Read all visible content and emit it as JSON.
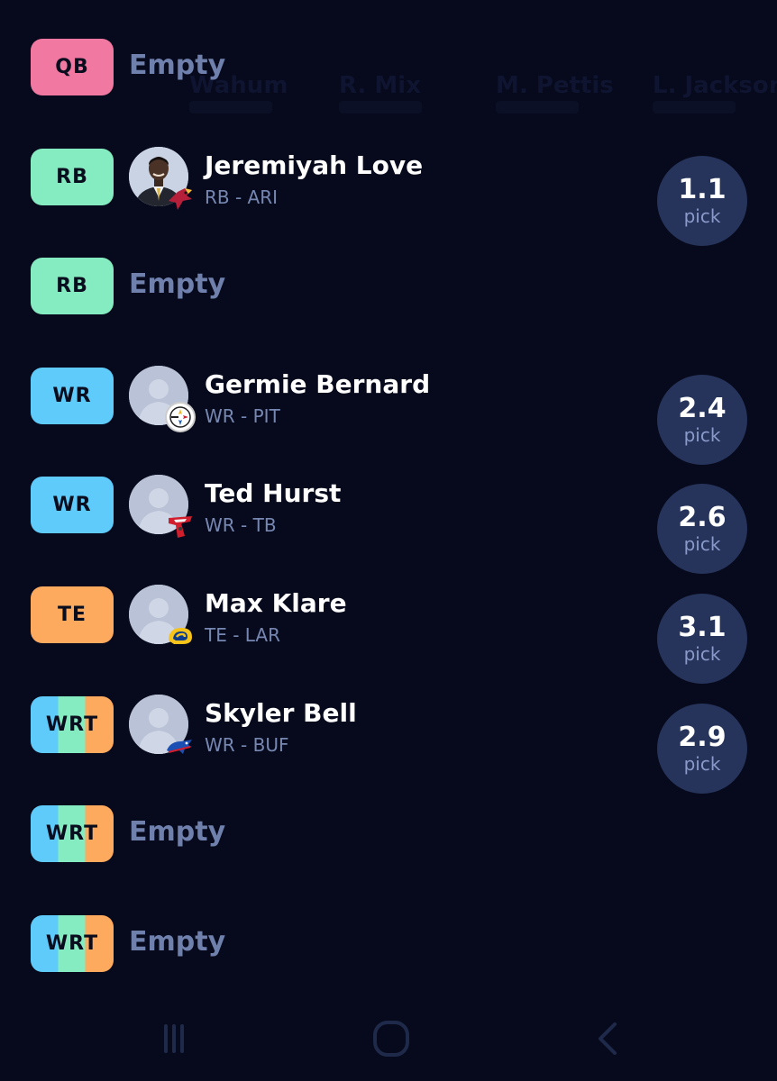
{
  "background_names": [
    "R. Mix",
    "M. Pettis",
    "L. Jackson",
    "Wahum"
  ],
  "slots": [
    {
      "position": "QB",
      "color": "#f178a1",
      "empty": true,
      "empty_label": "Empty"
    },
    {
      "position": "RB",
      "color": "#84ecc0",
      "empty": false,
      "player": {
        "name": "Jeremiyah Love",
        "meta": "RB - ARI",
        "team": "ARI",
        "team_logo": "cardinals-logo-icon",
        "avatar": "player-photo"
      },
      "pick": {
        "value": "1.1",
        "label": "pick"
      }
    },
    {
      "position": "RB",
      "color": "#84ecc0",
      "empty": true,
      "empty_label": "Empty"
    },
    {
      "position": "WR",
      "color": "#5ecbfb",
      "empty": false,
      "player": {
        "name": "Germie Bernard",
        "meta": "WR - PIT",
        "team": "PIT",
        "team_logo": "steelers-logo-icon",
        "avatar": "player-placeholder"
      },
      "pick": {
        "value": "2.4",
        "label": "pick"
      }
    },
    {
      "position": "WR",
      "color": "#5ecbfb",
      "empty": false,
      "player": {
        "name": "Ted Hurst",
        "meta": "WR - TB",
        "team": "TB",
        "team_logo": "buccaneers-logo-icon",
        "avatar": "player-placeholder"
      },
      "pick": {
        "value": "2.6",
        "label": "pick"
      }
    },
    {
      "position": "TE",
      "color": "#fdaa5f",
      "empty": false,
      "player": {
        "name": "Max Klare",
        "meta": "TE - LAR",
        "team": "LAR",
        "team_logo": "rams-logo-icon",
        "avatar": "player-placeholder"
      },
      "pick": {
        "value": "3.1",
        "label": "pick"
      }
    },
    {
      "position": "WRT",
      "color": "tricolor",
      "empty": false,
      "player": {
        "name": "Skyler Bell",
        "meta": "WR - BUF",
        "team": "BUF",
        "team_logo": "bills-logo-icon",
        "avatar": "player-placeholder"
      },
      "pick": {
        "value": "2.9",
        "label": "pick"
      }
    },
    {
      "position": "WRT",
      "color": "tricolor",
      "empty": true,
      "empty_label": "Empty"
    },
    {
      "position": "WRT",
      "color": "tricolor",
      "empty": true,
      "empty_label": "Empty"
    }
  ],
  "colors": {
    "background": "#070a1c",
    "pick_circle": "#26335a",
    "empty_text": "#6f80ac",
    "meta_text": "#7687b1",
    "wr": "#5ecbfb",
    "rb": "#84ecc0",
    "te": "#fdaa5f",
    "qb": "#f178a1"
  },
  "nav": [
    {
      "name": "recent-apps-button",
      "icon": "recent-apps-icon"
    },
    {
      "name": "home-button",
      "icon": "home-icon"
    },
    {
      "name": "back-button",
      "icon": "back-icon"
    }
  ]
}
